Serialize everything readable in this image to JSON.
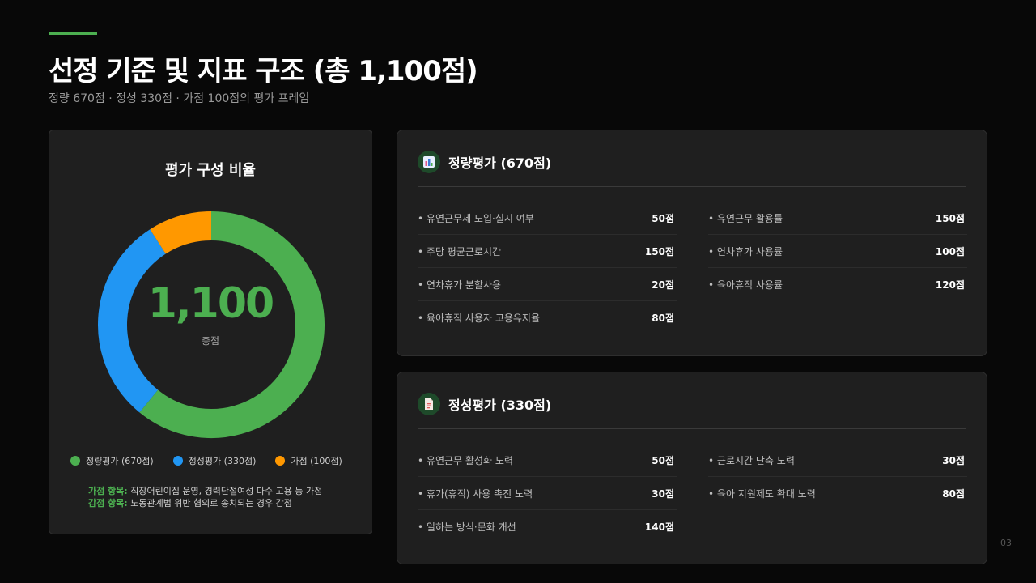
{
  "header": {
    "title": "선정 기준 및 지표 구조 (총 1,100점)",
    "subtitle": "정량 670점 · 정성 330점 · 가점 100점의 평가 프레임"
  },
  "colors": {
    "green": "#4caf50",
    "blue": "#2196f3",
    "orange": "#ff9800"
  },
  "chart_data": {
    "type": "pie",
    "title": "평가 구성 비율",
    "center_value": "1,100",
    "center_label": "총점",
    "categories": [
      "정량평가 (670점)",
      "정성평가 (330점)",
      "가점 (100점)"
    ],
    "values": [
      670,
      330,
      100
    ],
    "colors": [
      "#4caf50",
      "#2196f3",
      "#ff9800"
    ],
    "legend_position": "bottom"
  },
  "notes": {
    "bonus_key": "가점 항목:",
    "bonus_text": " 직장어린이집 운영, 경력단절여성 다수 고용 등 가점",
    "penalty_key": "감점 항목:",
    "penalty_text": " 노동관계법 위반 혐의로 송치되는 경우 감점"
  },
  "quant_card": {
    "icon": "bar-chart-icon",
    "title": "정량평가 (670점)",
    "left": [
      {
        "label": "유연근무제 도입·실시 여부",
        "points": "50점"
      },
      {
        "label": "주당 평균근로시간",
        "points": "150점"
      },
      {
        "label": "연차휴가 분할사용",
        "points": "20점"
      },
      {
        "label": "육아휴직 사용자 고용유지율",
        "points": "80점"
      }
    ],
    "right": [
      {
        "label": "유연근무 활용률",
        "points": "150점"
      },
      {
        "label": "연차휴가 사용률",
        "points": "100점"
      },
      {
        "label": "육아휴직 사용률",
        "points": "120점"
      }
    ]
  },
  "qual_card": {
    "icon": "document-icon",
    "title": "정성평가 (330점)",
    "left": [
      {
        "label": "유연근무 활성화 노력",
        "points": "50점"
      },
      {
        "label": "휴가(휴직) 사용 촉진 노력",
        "points": "30점"
      },
      {
        "label": "일하는 방식·문화 개선",
        "points": "140점"
      }
    ],
    "right": [
      {
        "label": "근로시간 단축 노력",
        "points": "30점"
      },
      {
        "label": "육아 지원제도 확대 노력",
        "points": "80점"
      }
    ]
  },
  "page_number": "03"
}
